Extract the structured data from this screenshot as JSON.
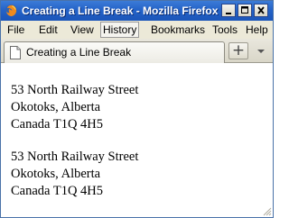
{
  "window": {
    "title": "Creating a Line Break - Mozilla Firefox"
  },
  "menu": {
    "items": [
      {
        "label": "File",
        "active": false
      },
      {
        "label": "Edit",
        "active": false
      },
      {
        "label": "View",
        "active": false
      },
      {
        "label": "History",
        "active": true
      },
      {
        "label": "Bookmarks",
        "active": false
      },
      {
        "label": "Tools",
        "active": false
      },
      {
        "label": "Help",
        "active": false
      }
    ]
  },
  "tabs": [
    {
      "label": "Creating a Line Break",
      "icon": "page-icon"
    }
  ],
  "tabbar": {
    "new_tab_label": "+"
  },
  "content": {
    "addresses": [
      {
        "lines": [
          "53 North Railway Street",
          "Okotoks, Alberta",
          "Canada T1Q 4H5"
        ]
      },
      {
        "lines": [
          "53 North Railway Street",
          "Okotoks, Alberta",
          "Canada T1Q 4H5"
        ]
      }
    ]
  },
  "colors": {
    "titlebar": "#2463c8",
    "chrome": "#ece9d8",
    "close_button": "#d9573b"
  }
}
